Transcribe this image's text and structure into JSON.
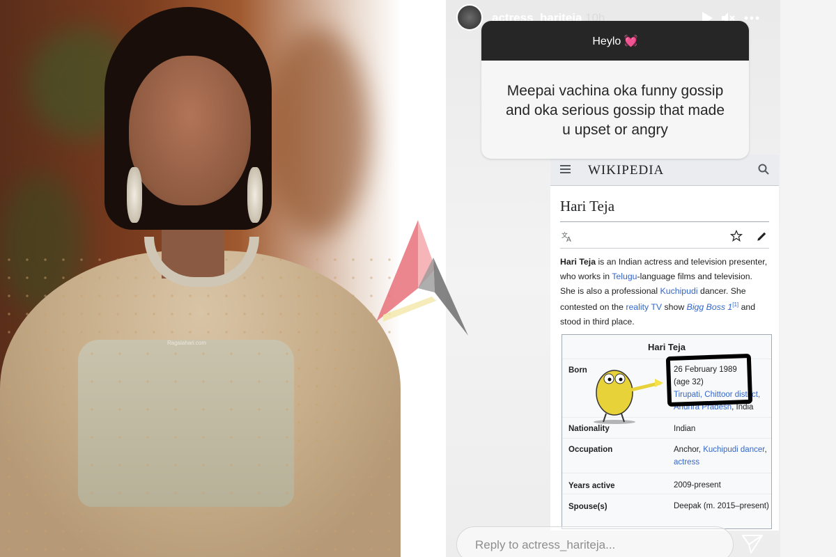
{
  "story": {
    "username": "actress_hariteja",
    "time": "10h",
    "icons": {
      "play": "play-icon",
      "mute": "mute-icon",
      "more": "more-icon",
      "send": "send-icon"
    },
    "reply_placeholder": "Reply to actress_hariteja..."
  },
  "question_sticker": {
    "header": "Heylo 💓",
    "question": "Meepai vachina oka funny gossip and oka serious gossip that made u upset or angry"
  },
  "wikipedia": {
    "logo": "WIKIPEDIA",
    "title": "Hari Teja",
    "intro": {
      "name": "Hari Teja",
      "p1": " is an Indian actress and television presenter, who works in ",
      "link1": "Telugu",
      "p2": "-language films and television. She is also a professional ",
      "link2": "Kuchipudi",
      "p3": " dancer. She contested on the ",
      "link3": "reality TV",
      "p4": " show ",
      "link4": "Bigg Boss 1",
      "ref": "[1]",
      "p5": " and stood in third place."
    },
    "infobox": {
      "title": "Hari Teja",
      "born_label": "Born",
      "born_date": "26 February 1989",
      "born_age": "(age 32)",
      "born_place_link1": "Tirupati, Chittoor district,",
      "born_place_link2": "Andhra Pradesh",
      "born_country": ", India",
      "nationality_label": "Nationality",
      "nationality_value": "Indian",
      "occupation_label": "Occupation",
      "occupation_p1": "Anchor, ",
      "occupation_link1": "Kuchipudi dancer",
      "occupation_sep": ", ",
      "occupation_link2": "actress",
      "years_label": "Years active",
      "years_value": "2009-present",
      "spouse_label": "Spouse(s)",
      "spouse_value": "Deepak (m. 2015–present)"
    }
  },
  "photo": {
    "watermark": "Ragalahari.com"
  },
  "colors": {
    "link": "#3366cc",
    "sticker_header": "#262626",
    "logo_red": "#e8717a",
    "logo_gray": "#6e6e6e"
  }
}
